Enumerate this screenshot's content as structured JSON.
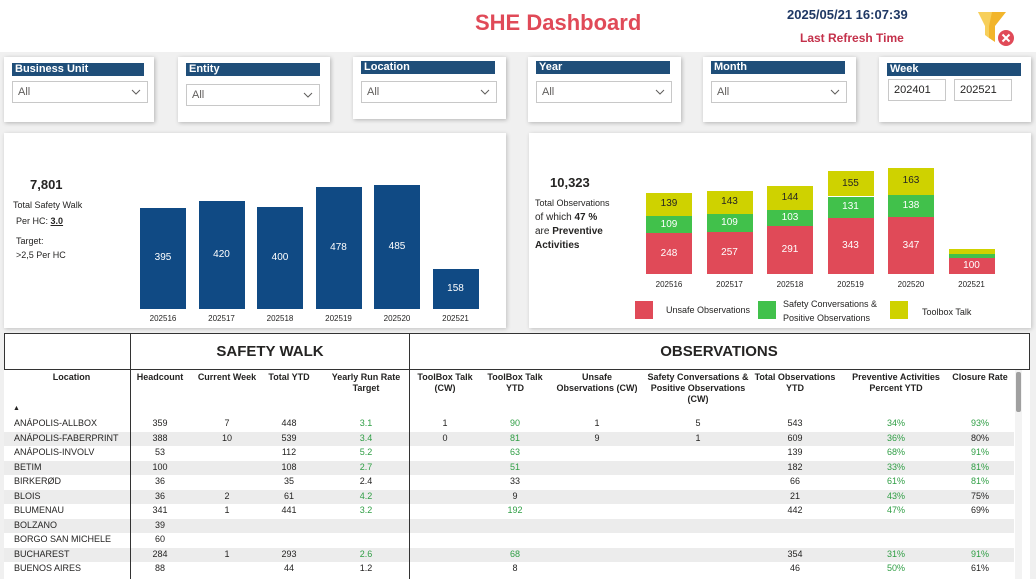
{
  "header": {
    "title": "SHE Dashboard",
    "datetime": "2025/05/21 16:07:39",
    "refresh_label": "Last Refresh Time"
  },
  "slicers": [
    {
      "label": "Business Unit",
      "value": "All"
    },
    {
      "label": "Entity",
      "value": "All"
    },
    {
      "label": "Location",
      "value": "All"
    },
    {
      "label": "Year",
      "value": "All"
    },
    {
      "label": "Month",
      "value": "All"
    }
  ],
  "week": {
    "label": "Week",
    "from": "202401",
    "to": "202521"
  },
  "safety_walk_kpi": {
    "total": "7,801",
    "total_label": "Total Safety Walk",
    "per_hc_label": "Per HC:",
    "per_hc_value": "3.0",
    "target_label": "Target:",
    "target_value": ">2,5 Per HC"
  },
  "observations_kpi": {
    "total": "10,323",
    "total_label": "Total Observations",
    "of_which": "of which",
    "percent": "47 %",
    "are": "are",
    "preventive": "Preventive",
    "activities": "Activities"
  },
  "colors": {
    "bar_blue": "#104a84",
    "unsafe": "#e04a58",
    "safety_conv": "#41c14b",
    "toolbox": "#cfd200"
  },
  "chart_data": [
    {
      "type": "bar",
      "categories": [
        "202516",
        "202517",
        "202518",
        "202519",
        "202520",
        "202521"
      ],
      "values": [
        395,
        420,
        400,
        478,
        485,
        158
      ],
      "ylim": [
        0,
        500
      ]
    },
    {
      "type": "bar",
      "stacked": true,
      "categories": [
        "202516",
        "202517",
        "202518",
        "202519",
        "202520",
        "202521"
      ],
      "series": [
        {
          "name": "Unsafe Observations",
          "values": [
            248,
            257,
            291,
            343,
            347,
            100
          ]
        },
        {
          "name": "Safety Conversations & Positive Observations",
          "values": [
            109,
            109,
            103,
            131,
            138,
            25
          ]
        },
        {
          "name": "Toolbox Talk",
          "values": [
            139,
            143,
            144,
            155,
            163,
            30
          ]
        }
      ],
      "value_labels": [
        [
          "248",
          "257",
          "291",
          "343",
          "347",
          "100"
        ],
        [
          "109",
          "109",
          "103",
          "131",
          "138",
          ""
        ],
        [
          "139",
          "143",
          "144",
          "155",
          "163",
          ""
        ]
      ],
      "legend": {
        "line1": [
          "Unsafe Observations",
          "Safety Conversations &",
          "Toolbox Talk"
        ],
        "line2": "Positive Observations"
      }
    }
  ],
  "table": {
    "group_safety": "SAFETY WALK",
    "group_obs": "OBSERVATIONS",
    "columns": [
      "Location",
      "Headcount",
      "Current Week",
      "Total YTD",
      "Yearly Run Rate Target",
      "ToolBox Talk (CW)",
      "ToolBox Talk YTD",
      "Unsafe Observations (CW)",
      "Safety Conversations & Positive Observations (CW)",
      "Total Observations YTD",
      "Preventive Activities Percent YTD",
      "Closure Rate"
    ],
    "sort_indicator": "▲",
    "rows": [
      [
        "ANÁPOLIS-ALLBOX",
        "359",
        "7",
        "448",
        "3.1",
        "1",
        "90",
        "1",
        "5",
        "543",
        "34%",
        "93%"
      ],
      [
        "ANÁPOLIS-FABERPRINT",
        "388",
        "10",
        "539",
        "3.4",
        "0",
        "81",
        "9",
        "1",
        "609",
        "36%",
        "80%"
      ],
      [
        "ANÁPOLIS-INVOLV",
        "53",
        "",
        "112",
        "5.2",
        "",
        "63",
        "",
        "",
        "139",
        "68%",
        "91%"
      ],
      [
        "BETIM",
        "100",
        "",
        "108",
        "2.7",
        "",
        "51",
        "",
        "",
        "182",
        "33%",
        "81%"
      ],
      [
        "BIRKERØD",
        "36",
        "",
        "35",
        "2.4",
        "",
        "33",
        "",
        "",
        "66",
        "61%",
        "81%"
      ],
      [
        "BLOIS",
        "36",
        "2",
        "61",
        "4.2",
        "",
        "9",
        "",
        "",
        "21",
        "43%",
        "75%"
      ],
      [
        "BLUMENAU",
        "341",
        "1",
        "441",
        "3.2",
        "",
        "192",
        "",
        "",
        "442",
        "47%",
        "69%"
      ],
      [
        "BOLZANO",
        "39",
        "",
        "",
        "",
        "",
        "",
        "",
        "",
        "",
        "",
        ""
      ],
      [
        "BORGO SAN MICHELE",
        "60",
        "",
        "",
        "",
        "",
        "",
        "",
        "",
        "",
        "",
        ""
      ],
      [
        "BUCHAREST",
        "284",
        "1",
        "293",
        "2.6",
        "",
        "68",
        "",
        "",
        "354",
        "31%",
        "91%"
      ],
      [
        "BUENOS AIRES",
        "88",
        "",
        "44",
        "1.2",
        "",
        "8",
        "",
        "",
        "46",
        "50%",
        "61%"
      ]
    ]
  }
}
